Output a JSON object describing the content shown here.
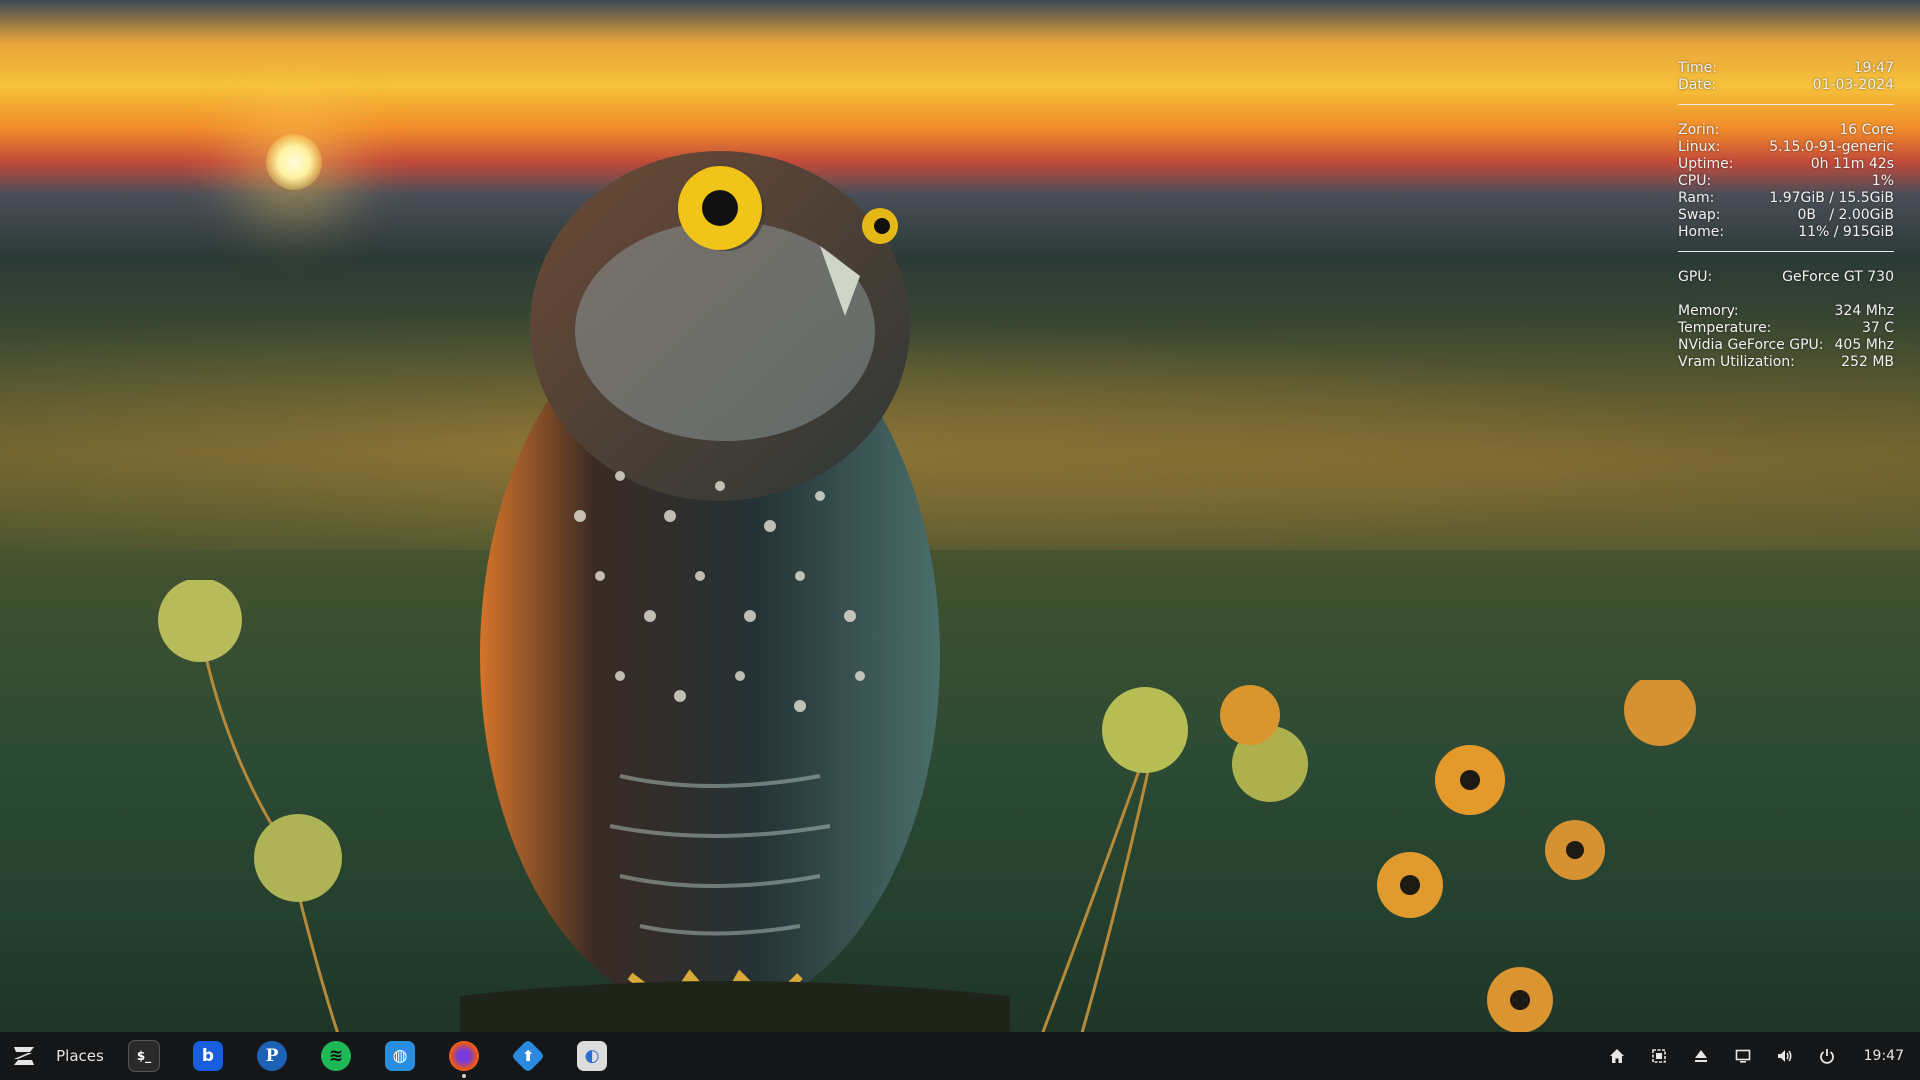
{
  "sysinfo": {
    "time": {
      "label": "Time:",
      "value": "19:47"
    },
    "date": {
      "label": "Date:",
      "value": "01-03-2024"
    },
    "zorin": {
      "label": "Zorin:",
      "value": "16 Core"
    },
    "linux": {
      "label": "Linux:",
      "value": "5.15.0-91-generic"
    },
    "uptime": {
      "label": "Uptime:",
      "value": "0h 11m 42s"
    },
    "cpu": {
      "label": "CPU:",
      "value": "1%"
    },
    "ram": {
      "label": "Ram:",
      "value": "1.97GiB / 15.5GiB"
    },
    "swap": {
      "label": "Swap:",
      "value": "0B   / 2.00GiB"
    },
    "home": {
      "label": "Home:",
      "value": "11% / 915GiB"
    },
    "gpu": {
      "label": "GPU:",
      "value": "GeForce GT 730"
    },
    "memory": {
      "label": "Memory:",
      "value": "324 Mhz"
    },
    "temperature": {
      "label": "Temperature:",
      "value": "37 C"
    },
    "nvidia": {
      "label": "NVidia GeForce GPU:",
      "value": "405 Mhz"
    },
    "vram": {
      "label": "Vram Utilization:",
      "value": "252 MB"
    }
  },
  "taskbar": {
    "menu_icon": "zorin-logo-icon",
    "places_label": "Places",
    "apps": [
      {
        "name": "terminal-icon",
        "glyph": "$_",
        "color": "#2a2a2a"
      },
      {
        "name": "bitwarden-icon",
        "glyph": "b",
        "color": "#175ddc"
      },
      {
        "name": "pcloud-icon",
        "glyph": "P",
        "color": "#1e62b8"
      },
      {
        "name": "spotify-icon",
        "glyph": "≋",
        "color": "#1db954"
      },
      {
        "name": "software-store-icon",
        "glyph": "◍",
        "color": "#2a8de0"
      },
      {
        "name": "firefox-icon",
        "glyph": "◉",
        "color": "#e8531f"
      },
      {
        "name": "update-icon",
        "glyph": "⬆",
        "color": "#2b8ae0"
      },
      {
        "name": "toggle-app-icon",
        "glyph": "◐",
        "color": "#dcdcdc"
      }
    ],
    "tray": [
      "home-icon",
      "screen-capture-icon",
      "eject-icon",
      "display-icon",
      "volume-icon",
      "power-icon"
    ],
    "clock": "19:47"
  }
}
